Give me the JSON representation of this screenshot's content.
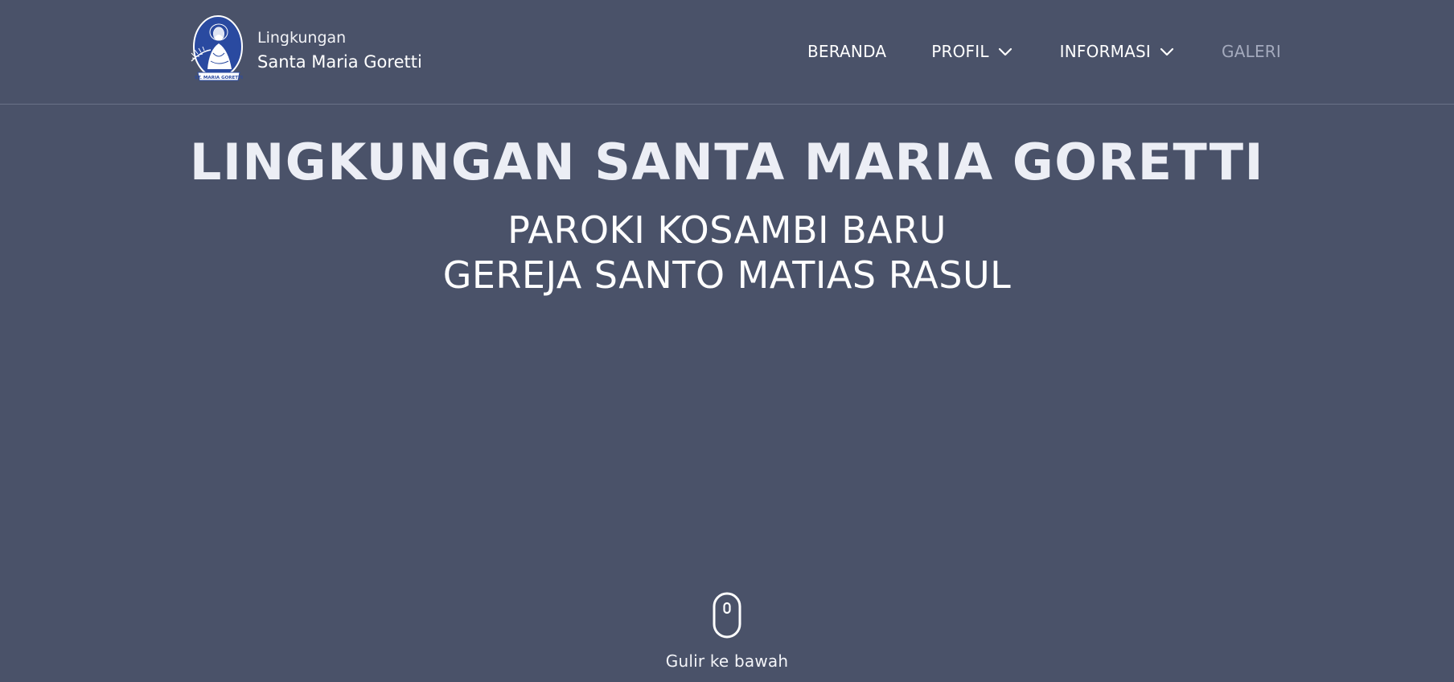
{
  "brand": {
    "line1": "Lingkungan",
    "line2": "Santa Maria Goretti",
    "logo_icon": "saint-maria-goretti-logo",
    "logo_colors": {
      "oval": "#2a4aa0",
      "ink": "#ffffff"
    }
  },
  "nav": {
    "items": [
      {
        "label": "BERANDA",
        "has_dropdown": false
      },
      {
        "label": "PROFIL",
        "has_dropdown": true,
        "icon": "chevron-down-icon"
      },
      {
        "label": "INFORMASI",
        "has_dropdown": true,
        "icon": "chevron-down-icon"
      },
      {
        "label": "GALERI",
        "has_dropdown": false,
        "muted": true
      }
    ]
  },
  "hero": {
    "title": "LINGKUNGAN SANTA MARIA GORETTI",
    "subtitle_line1": "PAROKI KOSAMBI BARU",
    "subtitle_line2": "GEREJA SANTO MATIAS RASUL"
  },
  "scroll": {
    "label": "Gulir ke bawah",
    "icon": "mouse-icon"
  },
  "colors": {
    "background": "#4a5269",
    "text": "#ffffff",
    "muted_nav": "#a4aabd",
    "divider": "#6a7187"
  }
}
